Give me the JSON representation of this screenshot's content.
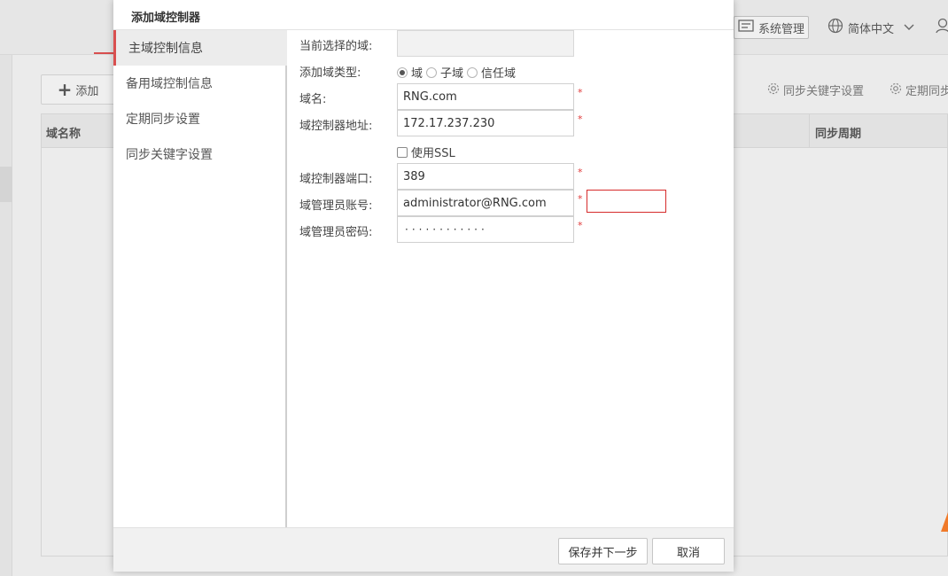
{
  "background": {
    "nav": {
      "system_label": "系统管理",
      "language_label": "简体中文"
    },
    "toolbar": {
      "add_label": "添加",
      "sync_keyword_label": "同步关键字设置",
      "scheduled_sync_label": "定期同步"
    },
    "table": {
      "columns": [
        "域名称",
        "同步周期"
      ]
    }
  },
  "modal": {
    "title": "添加域控制器",
    "tabs": [
      {
        "label": "主域控制信息",
        "active": true
      },
      {
        "label": "备用域控制信息",
        "active": false
      },
      {
        "label": "定期同步设置",
        "active": false
      },
      {
        "label": "同步关键字设置",
        "active": false
      }
    ],
    "form": {
      "current_domain": {
        "label": "当前选择的域:",
        "value": ""
      },
      "domain_type": {
        "label": "添加域类型:",
        "options": [
          "域",
          "子域",
          "信任域"
        ],
        "selected": "域"
      },
      "domain_name": {
        "label": "域名:",
        "value": "RNG.com",
        "required": "*"
      },
      "controller_address": {
        "label": "域控制器地址:",
        "value": "172.17.237.230",
        "required": "*"
      },
      "use_ssl": {
        "label": "使用SSL",
        "checked": false
      },
      "controller_port": {
        "label": "域控制器端口:",
        "value": "389",
        "required": "*"
      },
      "admin_account": {
        "label": "域管理员账号:",
        "value": "administrator@RNG.com",
        "required": "*"
      },
      "admin_password": {
        "label": "域管理员密码:",
        "value": "············",
        "required": "*"
      }
    },
    "footer": {
      "save_next_label": "保存并下一步",
      "cancel_label": "取消"
    }
  },
  "colors": {
    "accent_red": "#d94f4f",
    "required_red": "#e03b3b",
    "warning_orange": "#f07a2a"
  }
}
